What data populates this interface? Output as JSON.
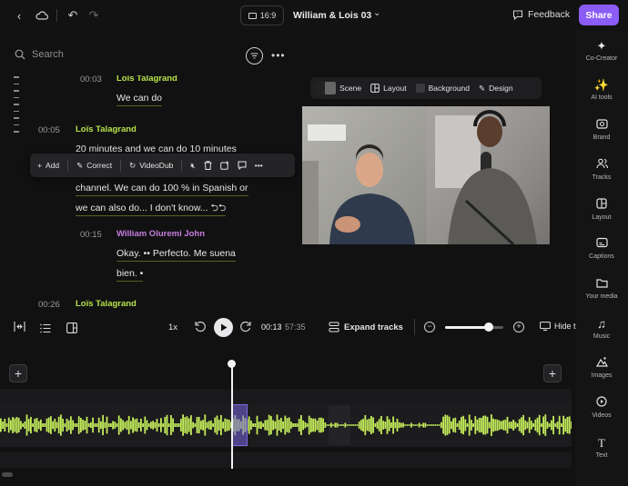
{
  "topbar": {
    "aspect_ratio": "16:9",
    "project_title": "William & Lois 03",
    "feedback_label": "Feedback",
    "share_label": "Share"
  },
  "sidebar": {
    "items": [
      {
        "label": "Co-Creator",
        "icon": "sparkle-icon"
      },
      {
        "label": "AI tools",
        "icon": "magic-icon"
      },
      {
        "label": "Brand",
        "icon": "brand-icon"
      },
      {
        "label": "Tracks",
        "icon": "people-icon"
      },
      {
        "label": "Layout",
        "icon": "layout-icon"
      },
      {
        "label": "Captions",
        "icon": "captions-icon"
      },
      {
        "label": "Your media",
        "icon": "folder-icon"
      },
      {
        "label": "Music",
        "icon": "music-icon"
      },
      {
        "label": "Images",
        "icon": "image-icon"
      },
      {
        "label": "Videos",
        "icon": "video-icon"
      },
      {
        "label": "Text",
        "icon": "text-icon"
      }
    ]
  },
  "transcript": {
    "search_placeholder": "Search",
    "blocks": [
      {
        "time": "00:03",
        "speaker": "Loïs Talagrand",
        "lines": [
          "We can do"
        ]
      },
      {
        "time": "00:05",
        "speaker": "Loïs Talagrand",
        "lines": [
          "20 minutes and we can do 10 minutes",
          "channel. We can do 100 % in Spanish or",
          "we can also do... I don't know... ⮌⮌"
        ]
      },
      {
        "time": "00:15",
        "speaker": "William Oluremi John",
        "lines": [
          "Okay. •• Perfecto. Me suena",
          "bien. •"
        ]
      },
      {
        "time": "00:26",
        "speaker": "Loïs Talagrand",
        "lines": []
      }
    ],
    "toolbar": {
      "add": "Add",
      "correct": "Correct",
      "videodub": "VideoDub"
    }
  },
  "scene_bar": {
    "scene": "Scene",
    "layout": "Layout",
    "background": "Background",
    "design": "Design"
  },
  "transport": {
    "speed": "1x",
    "current_time": "00:13",
    "separator": "/",
    "total_time": "57:35",
    "expand_tracks": "Expand tracks",
    "hide_label": "Hide t",
    "zoom_level": 0.75
  },
  "colors": {
    "accent": "#8b5cf6",
    "speaker_lois": "#b5e34a",
    "speaker_william": "#c77ddf",
    "waveform": "#c4ec5a"
  }
}
